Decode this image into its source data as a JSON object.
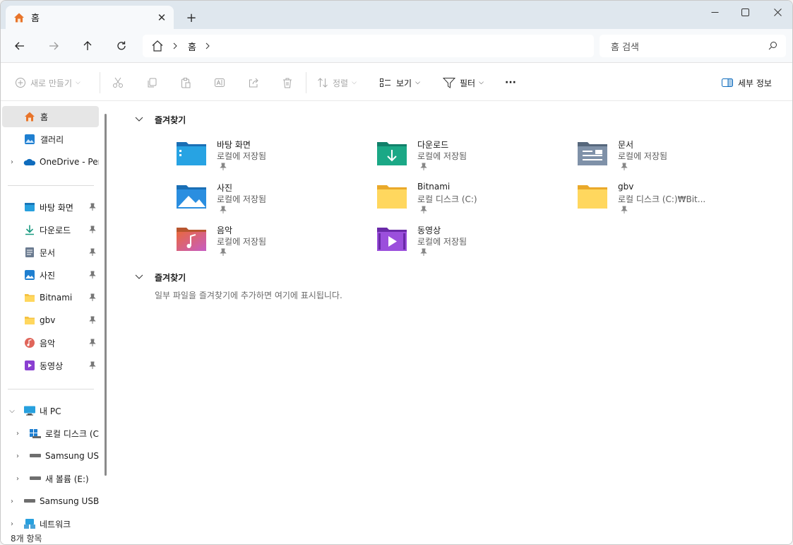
{
  "tab": {
    "title": "홈",
    "icon": "home-icon",
    "new_tab": "+"
  },
  "address": {
    "crumb": "홈"
  },
  "search": {
    "placeholder": "홈 검색"
  },
  "commands": {
    "new": "새로 만들기",
    "sort": "정렬",
    "view": "보기",
    "filter": "필터",
    "more": "···",
    "details": "세부 정보"
  },
  "sidebar": {
    "top": [
      {
        "label": "홈",
        "icon": "home-icon"
      },
      {
        "label": "갤러리",
        "icon": "gallery-icon"
      },
      {
        "label": "OneDrive - Pers",
        "icon": "onedrive-icon"
      }
    ],
    "quick": [
      {
        "label": "바탕 화면",
        "icon": "desktop-icon"
      },
      {
        "label": "다운로드",
        "icon": "download-icon"
      },
      {
        "label": "문서",
        "icon": "documents-icon"
      },
      {
        "label": "사진",
        "icon": "pictures-icon"
      },
      {
        "label": "Bitnami",
        "icon": "folder-icon"
      },
      {
        "label": "gbv",
        "icon": "folder-icon"
      },
      {
        "label": "음악",
        "icon": "music-icon"
      },
      {
        "label": "동영상",
        "icon": "video-icon"
      }
    ],
    "pc": [
      {
        "label": "내 PC",
        "icon": "pc-icon"
      },
      {
        "label": "로컬 디스크 (C",
        "icon": "windows-drive-icon"
      },
      {
        "label": "Samsung USB",
        "icon": "usb-drive-icon"
      },
      {
        "label": "새 볼륨 (E:)",
        "icon": "drive-icon"
      },
      {
        "label": "Samsung USB (",
        "icon": "usb-drive-icon"
      },
      {
        "label": "네트워크",
        "icon": "network-icon"
      }
    ]
  },
  "main": {
    "section1": "즐겨찾기",
    "section2": "즐겨찾기",
    "empty_text": "일부 파일을 즐겨찾기에 추가하면 여기에 표시됩니다.",
    "tiles": [
      {
        "name": "바탕 화면",
        "sub": "로컬에 저장됨",
        "icon": "desktop-folder-icon"
      },
      {
        "name": "다운로드",
        "sub": "로컬에 저장됨",
        "icon": "downloads-folder-icon"
      },
      {
        "name": "문서",
        "sub": "로컬에 저장됨",
        "icon": "documents-folder-icon"
      },
      {
        "name": "사진",
        "sub": "로컬에 저장됨",
        "icon": "pictures-folder-icon"
      },
      {
        "name": "Bitnami",
        "sub": "로컬 디스크 (C:)",
        "icon": "folder-icon"
      },
      {
        "name": "gbv",
        "sub": "로컬 디스크 (C:)₩Bit...",
        "icon": "folder-icon"
      },
      {
        "name": "음악",
        "sub": "로컬에 저장됨",
        "icon": "music-folder-icon"
      },
      {
        "name": "동영상",
        "sub": "로컬에 저장됨",
        "icon": "videos-folder-icon"
      }
    ]
  },
  "status": {
    "count": "8개 항목"
  },
  "colors": {
    "accent": "#0f6cbd",
    "folder_yellow": "#f5c242",
    "selected": "#e6e6e6"
  }
}
